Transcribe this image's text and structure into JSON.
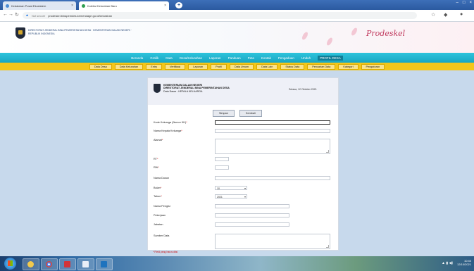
{
  "browser": {
    "tabs": [
      {
        "title": "Kedataran Pusat Ekosistem",
        "active": false
      },
      {
        "title": "Koleksi Kelurahan Baru",
        "active": true
      }
    ],
    "url": "prodeskel.binapemdes.kemendagri.go.id/kelurahan",
    "security_label": "Not secure"
  },
  "header": {
    "ministry": "DIREKTORAT JENDERAL BINA PEMERINTAHAN DESA · KEMENTERIAN DALAM NEGERI · REPUBLIK INDONESIA",
    "signature": "Prodeskel"
  },
  "menu_primary": [
    "Beranda",
    "Grafik",
    "Data",
    "Desa/Kelurahan",
    "Laporan",
    "Panduan",
    "Peta",
    "Kontak",
    "Pengaduan",
    "Unduh",
    "PROFIL DESA"
  ],
  "menu_secondary": [
    "Data Desa",
    "Data Kelurahan",
    "Entry",
    "Verifikasi",
    "Laporan",
    "Profil",
    "Data Umum",
    "Data Lain",
    "Status Data",
    "Pencarian Data",
    "Kategori",
    "Pengaturan"
  ],
  "form": {
    "title": "KEMENTERIAN DALAM NEGERI",
    "subtitle": "DIREKTORAT JENDERAL BINA PEMERINTAHAN DESA",
    "unit": "Data Dasar - KEPALA KELUARGA",
    "date": "Selasa, 12 Oktober 2021",
    "buttons": {
      "save": "Simpan",
      "back": "Kembali"
    },
    "fields": {
      "nomor_kk": "Kode Keluarga (Nomor KK)",
      "nama_kk": "Nama Kepala Keluarga",
      "alamat": "Alamat",
      "rt": "RT",
      "rw": "RW",
      "nama_dusun": "Nama Dusun",
      "bulan": "Bulan",
      "tahun": "Tahun",
      "nama_pengisi": "Nama Pengisi",
      "pekerjaan": "Pekerjaan",
      "jabatan": "Jabatan",
      "sumber_data": "Sumber Data"
    },
    "values": {
      "bulan": "10",
      "tahun": "2021"
    },
    "required_note": "* Field yang harus diisi"
  },
  "taskbar": {
    "time": "10:40",
    "date": "12/10/2021"
  }
}
